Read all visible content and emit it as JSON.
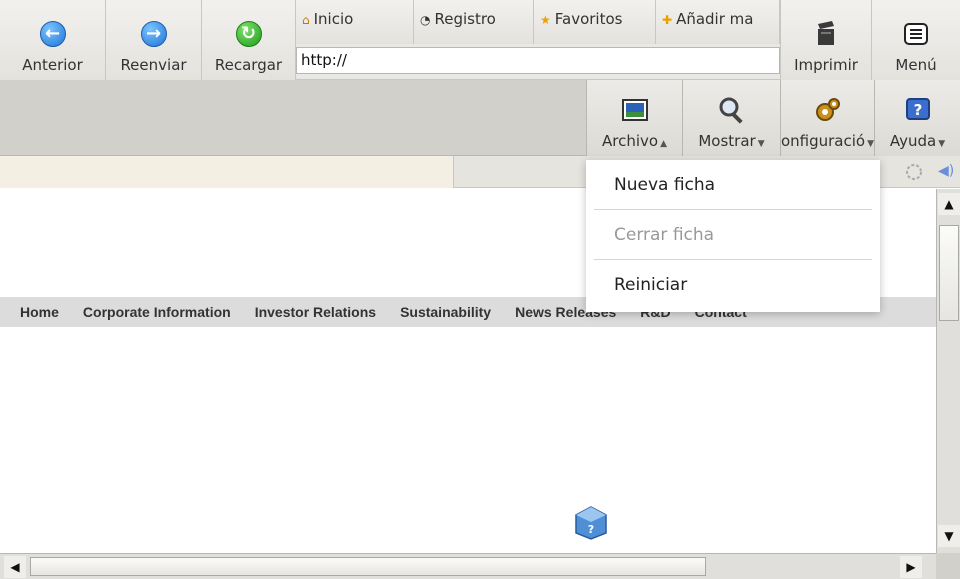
{
  "toolbar": {
    "back_label": "Anterior",
    "forward_label": "Reenviar",
    "reload_label": "Recargar",
    "print_label": "Imprimir",
    "menu_label": "Menú"
  },
  "bookmarks": [
    {
      "glyph": "⌂",
      "label": "Inicio"
    },
    {
      "glyph": "◔",
      "label": "Registro"
    },
    {
      "glyph": "★",
      "label": "Favoritos"
    },
    {
      "glyph": "✚",
      "label": "Añadir ma"
    }
  ],
  "address_bar": {
    "value": "http://"
  },
  "secondary_toolbar": {
    "file_label": "Archivo",
    "view_label": "Mostrar",
    "settings_label": "onfiguració",
    "help_label": "Ayuda"
  },
  "file_menu": {
    "items": [
      {
        "label": "Nueva ficha",
        "enabled": true
      },
      {
        "label": "Cerrar ficha",
        "enabled": false
      },
      {
        "label": "Reiniciar",
        "enabled": true
      }
    ]
  },
  "page": {
    "nav_items": [
      "Home",
      "Corporate Information",
      "Investor Relations",
      "Sustainability",
      "News Releases",
      "R&D",
      "Contact"
    ]
  },
  "icons": {
    "back": "arrow-left-icon",
    "forward": "arrow-right-icon",
    "reload": "reload-icon",
    "print": "clapperboard-icon",
    "menu": "menu-icon",
    "file": "picture-icon",
    "view": "magnifier-icon",
    "settings": "gears-icon",
    "help": "help-icon"
  },
  "colors": {
    "accent_blue": "#1f74d6",
    "accent_green": "#1f9b1a",
    "tab_bg": "#f4efe3"
  }
}
